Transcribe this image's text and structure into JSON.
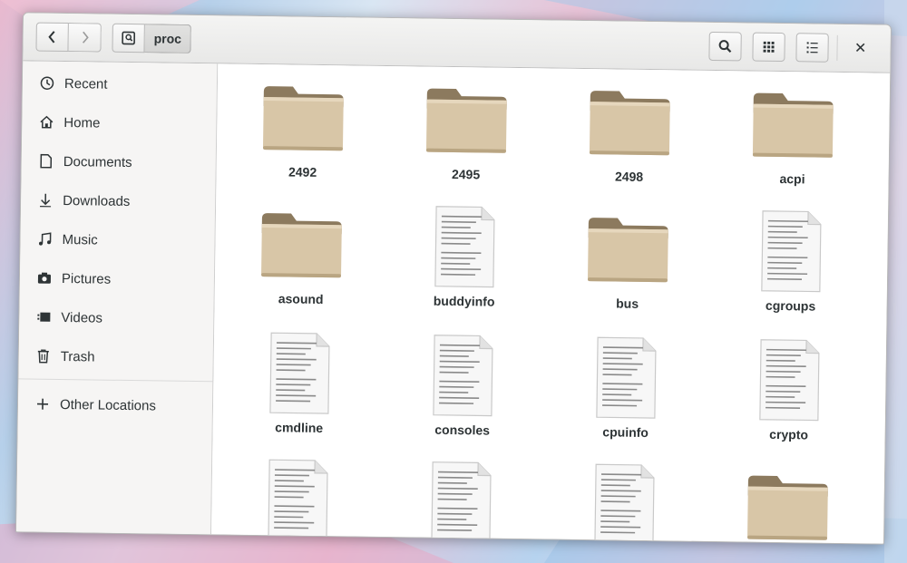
{
  "window": {
    "path": [
      "proc"
    ]
  },
  "toolbar": {
    "back_icon": "chevron-left-icon",
    "forward_icon": "chevron-right-icon",
    "home_icon": "home-folder-icon",
    "search_icon": "search-icon",
    "view_icon": "grid-view-icon",
    "menu_icon": "view-options-icon",
    "close_icon": "close-icon",
    "close_glyph": "✕"
  },
  "sidebar": {
    "items": [
      {
        "label": "Recent",
        "icon": "clock-icon"
      },
      {
        "label": "Home",
        "icon": "home-icon"
      },
      {
        "label": "Documents",
        "icon": "document-icon"
      },
      {
        "label": "Downloads",
        "icon": "download-icon"
      },
      {
        "label": "Music",
        "icon": "music-icon"
      },
      {
        "label": "Pictures",
        "icon": "camera-icon"
      },
      {
        "label": "Videos",
        "icon": "video-icon"
      },
      {
        "label": "Trash",
        "icon": "trash-icon"
      }
    ],
    "other": {
      "label": "Other Locations",
      "icon": "plus-icon"
    }
  },
  "files": [
    {
      "name": "2492",
      "type": "folder"
    },
    {
      "name": "2495",
      "type": "folder"
    },
    {
      "name": "2498",
      "type": "folder"
    },
    {
      "name": "acpi",
      "type": "folder"
    },
    {
      "name": "asound",
      "type": "folder"
    },
    {
      "name": "buddyinfo",
      "type": "text"
    },
    {
      "name": "bus",
      "type": "folder"
    },
    {
      "name": "cgroups",
      "type": "text"
    },
    {
      "name": "cmdline",
      "type": "text"
    },
    {
      "name": "consoles",
      "type": "text"
    },
    {
      "name": "cpuinfo",
      "type": "text"
    },
    {
      "name": "crypto",
      "type": "text"
    },
    {
      "name": "",
      "type": "text"
    },
    {
      "name": "",
      "type": "text"
    },
    {
      "name": "",
      "type": "text"
    },
    {
      "name": "",
      "type": "folder"
    }
  ],
  "colors": {
    "folder_body": "#d8c6a7",
    "folder_tab": "#8c7a5e",
    "accent_text": "#2e3436"
  }
}
